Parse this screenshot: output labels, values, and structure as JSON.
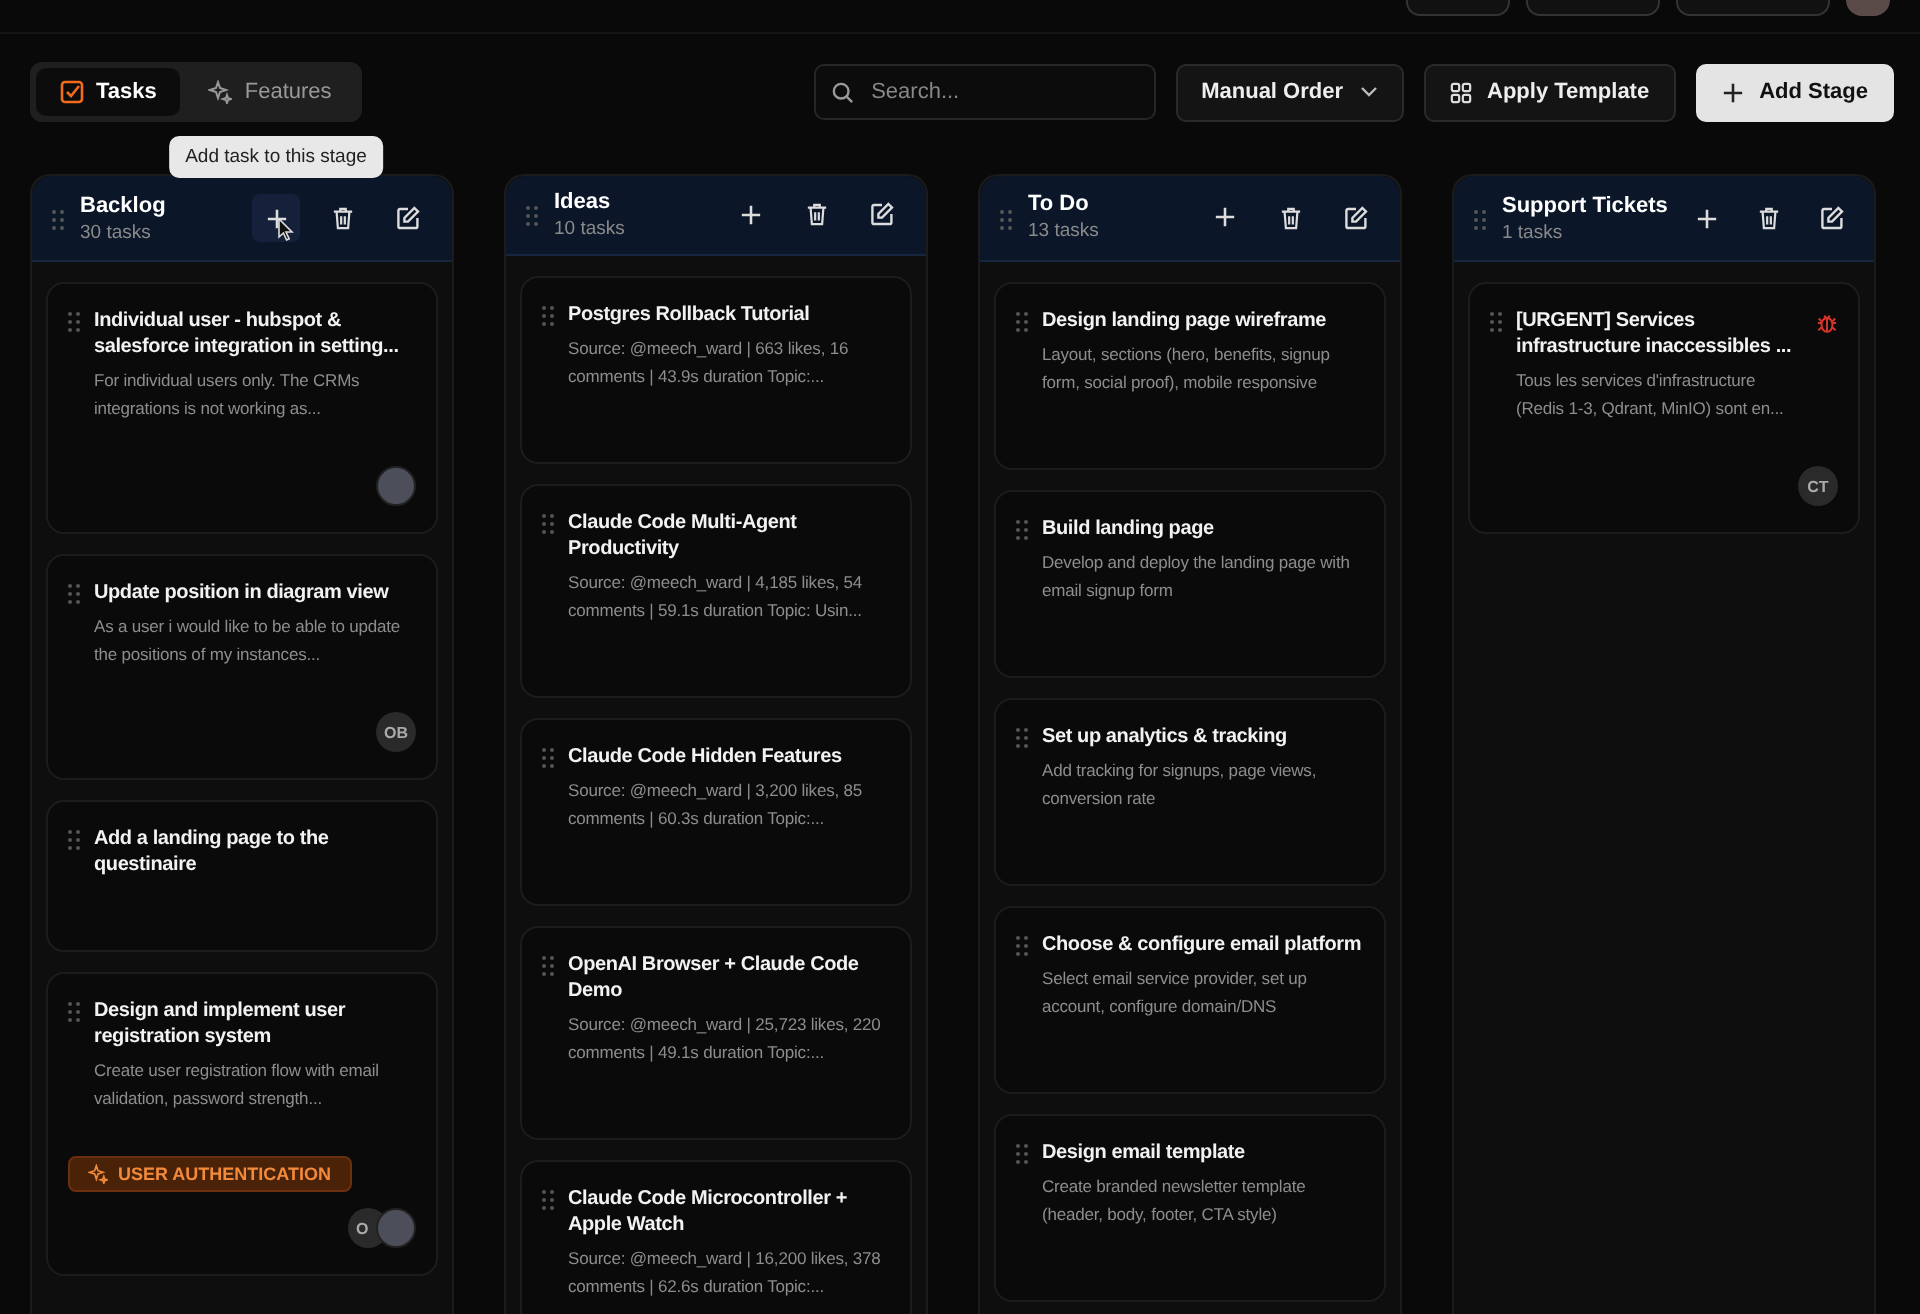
{
  "view_tabs": [
    {
      "label": "Tasks",
      "selected": true
    },
    {
      "label": "Features",
      "selected": false
    }
  ],
  "search": {
    "placeholder": "Search..."
  },
  "sort_dropdown": {
    "value": "Manual Order"
  },
  "buttons": [
    {
      "label": "Apply Template",
      "kind": "secondary"
    },
    {
      "label": "Add Stage",
      "kind": "primary"
    }
  ],
  "stages": [
    {
      "name": "Backlog",
      "count": "30 tasks",
      "add_hovered": true,
      "tooltip": "Add task to this stage",
      "cards": [
        {
          "title": "Individual user - hubspot & salesforce integration in setting...",
          "description": "For individual users only. The CRMs integrations is not working as...",
          "bug": false,
          "assignees": [
            {
              "kind": "photo"
            }
          ]
        },
        {
          "title": "Update position in diagram view",
          "description": "As a user i would like to be able to update the positions of my instances...",
          "bug": false,
          "assignees": [
            {
              "kind": "initials",
              "text": "OB"
            }
          ]
        },
        {
          "title": "Add a landing page to the questinaire",
          "bug": false
        },
        {
          "title": "Design and implement user registration system",
          "description": "Create user registration flow with email validation, password strength...",
          "bug": false,
          "tag": "USER AUTHENTICATION",
          "assignees": [
            {
              "kind": "initials",
              "text": "O"
            },
            {
              "kind": "photo"
            }
          ]
        }
      ]
    },
    {
      "name": "Ideas",
      "count": "10 tasks",
      "add_hovered": false,
      "cards": [
        {
          "title": "Postgres Rollback Tutorial",
          "description": "Source: @meech_ward | 663 likes, 16 comments | 43.9s duration Topic:...",
          "bug": false
        },
        {
          "title": "Claude Code Multi-Agent Productivity",
          "description": "Source: @meech_ward | 4,185 likes, 54 comments | 59.1s duration Topic: Usin...",
          "bug": false
        },
        {
          "title": "Claude Code Hidden Features",
          "description": "Source: @meech_ward | 3,200 likes, 85 comments | 60.3s duration Topic:...",
          "bug": false
        },
        {
          "title": "OpenAI Browser + Claude Code Demo",
          "description": "Source: @meech_ward | 25,723 likes, 220 comments | 49.1s duration Topic:...",
          "bug": false
        },
        {
          "title": "Claude Code Microcontroller + Apple Watch",
          "description": "Source: @meech_ward | 16,200 likes, 378 comments | 62.6s duration Topic:...",
          "bug": false
        }
      ]
    },
    {
      "name": "To Do",
      "count": "13 tasks",
      "add_hovered": false,
      "cards": [
        {
          "title": "Design landing page wireframe",
          "description": "Layout, sections (hero, benefits, signup form, social proof), mobile responsive",
          "bug": false
        },
        {
          "title": "Build landing page",
          "description": "Develop and deploy the landing page with email signup form",
          "bug": false
        },
        {
          "title": "Set up analytics & tracking",
          "description": "Add tracking for signups, page views, conversion rate",
          "bug": false
        },
        {
          "title": "Choose & configure email platform",
          "description": "Select email service provider, set up account, configure domain/DNS",
          "bug": false
        },
        {
          "title": "Design email template",
          "description": "Create branded newsletter template (header, body, footer, CTA style)",
          "bug": false
        }
      ]
    },
    {
      "name": "Support Tickets",
      "count": "1 tasks",
      "add_hovered": false,
      "cards": [
        {
          "title": "[URGENT] Services infrastructure inaccessibles ...",
          "description": "Tous les services d'infrastructure (Redis 1-3, Qdrant, MinIO) sont en...",
          "bug": true,
          "assignees": [
            {
              "kind": "initials",
              "text": "CT"
            }
          ]
        }
      ]
    }
  ]
}
